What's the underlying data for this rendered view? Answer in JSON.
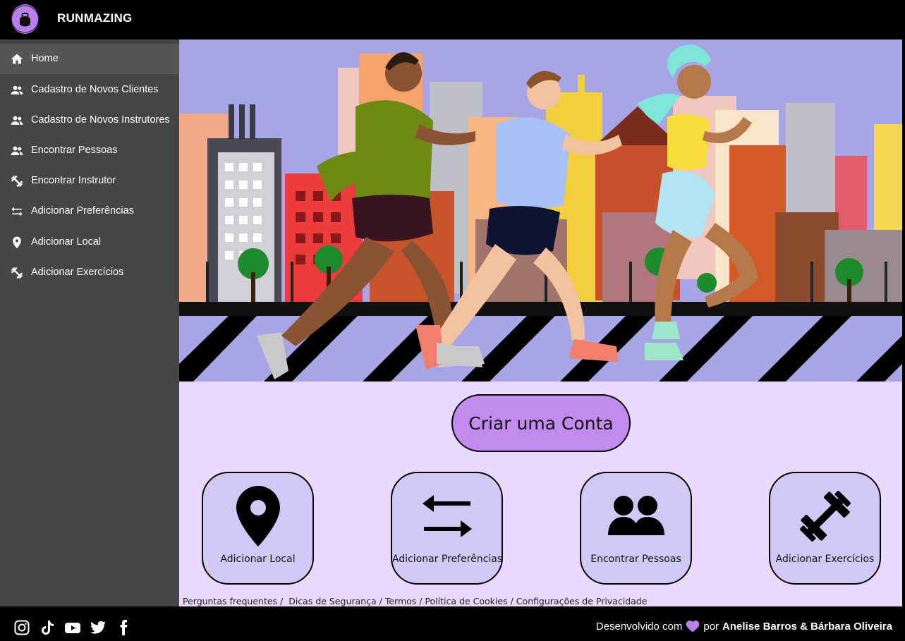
{
  "app": {
    "title": "RUNMAZING",
    "logo_text": "RUNMAZING",
    "accent": "#c38bf0"
  },
  "sidebar": {
    "items": [
      {
        "label": "Home",
        "icon": "home-icon"
      },
      {
        "label": "Cadastro de Novos Clientes",
        "icon": "people-icon"
      },
      {
        "label": "Cadastro de Novos Instrutores",
        "icon": "people-icon"
      },
      {
        "label": "Encontrar Pessoas",
        "icon": "people-icon"
      },
      {
        "label": "Encontrar Instrutor",
        "icon": "dumbbell-icon"
      },
      {
        "label": "Adicionar Preferências",
        "icon": "swap-arrows-icon"
      },
      {
        "label": "Adicionar Local",
        "icon": "location-pin-icon"
      },
      {
        "label": "Adicionar Exercícios",
        "icon": "dumbbell-icon"
      }
    ]
  },
  "main": {
    "cta_label": "Criar uma Conta",
    "cards": [
      {
        "label": "Adicionar Local",
        "icon": "location-pin-icon"
      },
      {
        "label": "Adicionar Preferências",
        "icon": "swap-arrows-icon"
      },
      {
        "label": "Encontrar Pessoas",
        "icon": "people-icon"
      },
      {
        "label": "Adicionar Exercícios",
        "icon": "dumbbell-icon"
      }
    ],
    "footer_links": [
      "Perguntas frequentes",
      "Dicas de Segurança",
      "Termos",
      "Política de Cookies",
      "Configurações de Privacidade"
    ]
  },
  "bottom": {
    "social": [
      "instagram-icon",
      "tiktok-icon",
      "youtube-icon",
      "twitter-icon",
      "facebook-icon"
    ],
    "credits_prefix": "Desenvolvido com",
    "credits_by": "por",
    "credits_names": "Anelise Barros & Bárbara Oliveira",
    "heart_color": "#b980ee"
  }
}
